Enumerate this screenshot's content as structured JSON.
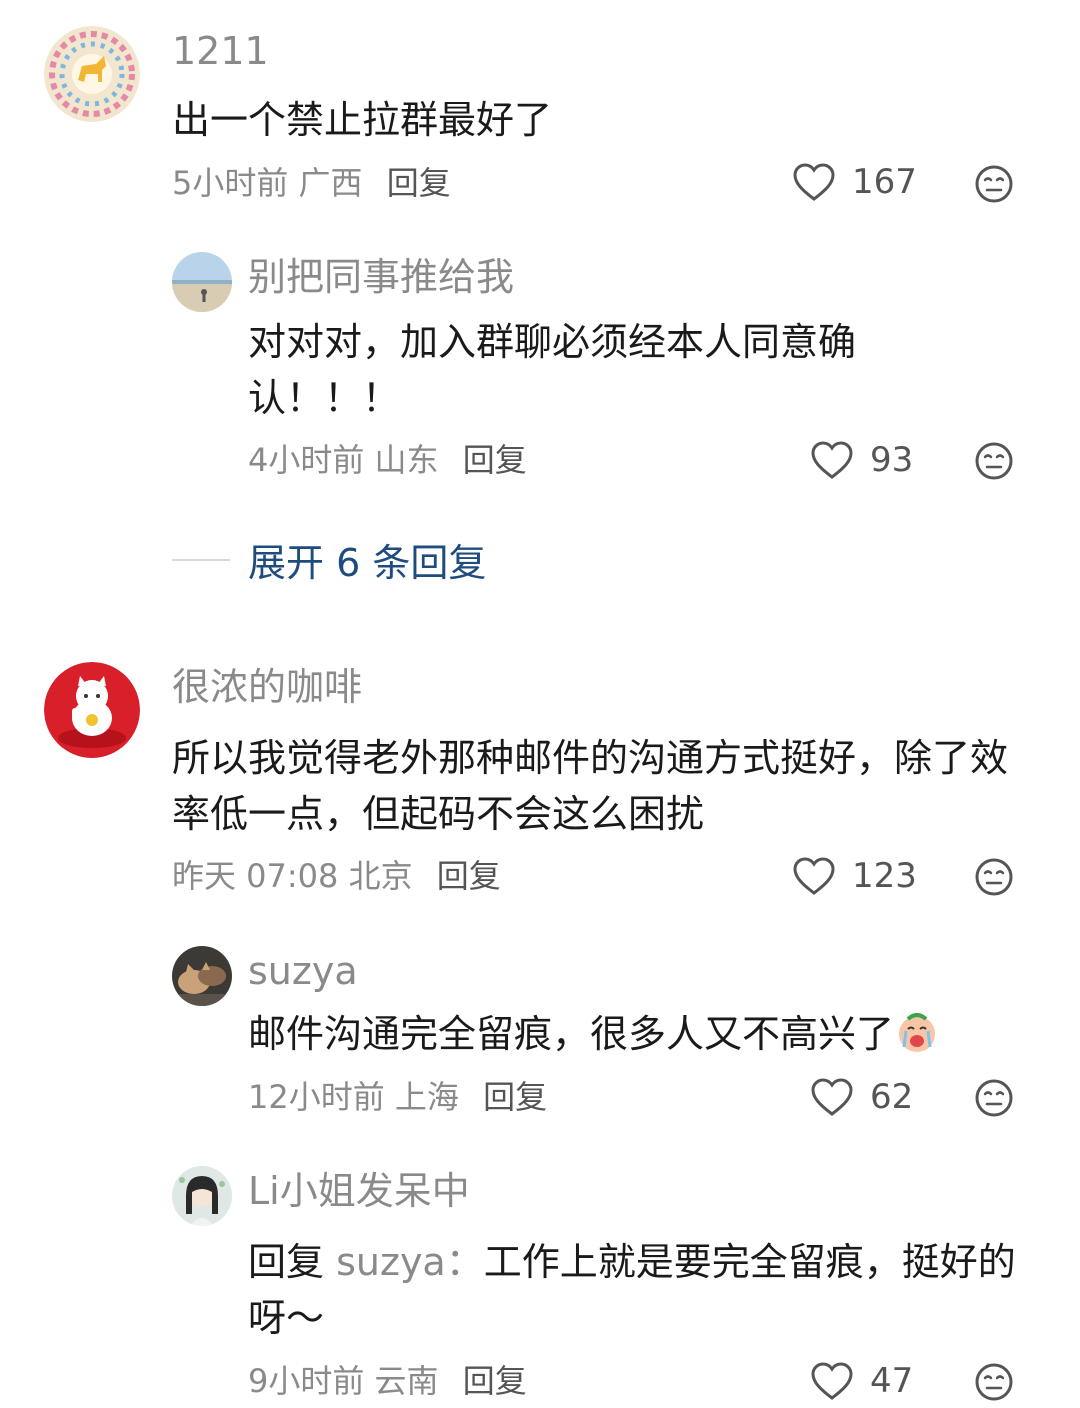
{
  "comments": [
    {
      "user": "1211",
      "text": "出一个禁止拉群最好了",
      "time": "5小时前",
      "location": "广西",
      "reply_label": "回复",
      "likes": "167"
    },
    {
      "user": "别把同事推给我",
      "text": "对对对，加入群聊必须经本人同意确认！！！",
      "time": "4小时前",
      "location": "山东",
      "reply_label": "回复",
      "likes": "93"
    },
    {
      "user": "很浓的咖啡",
      "text": "所以我觉得老外那种邮件的沟通方式挺好，除了效率低一点，但起码不会这么困扰",
      "time": "昨天 07:08",
      "location": "北京",
      "reply_label": "回复",
      "likes": "123"
    },
    {
      "user": "suzya",
      "text": "邮件沟通完全留痕，很多人又不高兴了",
      "time": "12小时前",
      "location": "上海",
      "reply_label": "回复",
      "likes": "62"
    },
    {
      "user": "Li小姐发呆中",
      "reply_prefix": "回复",
      "reply_to": "suzya：",
      "text": "工作上就是要完全留痕，挺好的呀～",
      "time": "9小时前",
      "location": "云南",
      "reply_label": "回复",
      "likes": "47"
    }
  ],
  "expand_replies": "展开 6 条回复",
  "icons": {
    "like": "heart-outline-icon",
    "dislike": "meh-face-icon"
  },
  "colors": {
    "link": "#1e4c7e",
    "secondary": "#8a8a8a"
  }
}
